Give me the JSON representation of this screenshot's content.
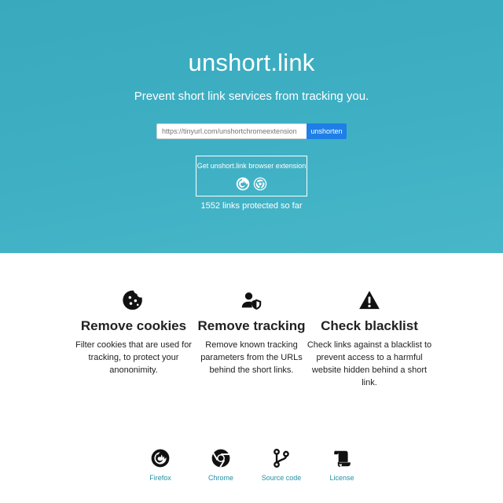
{
  "hero": {
    "title": "unshort.link",
    "subtitle": "Prevent short link services from tracking you.",
    "url_input_placeholder": "https://tinyurl.com/unshortchromeextension",
    "unshorten_label": "unshorten",
    "extension_label": "Get unshort.link browser extension",
    "extension_icons": [
      "firefox-icon",
      "chrome-icon"
    ],
    "counter_text": "1552 links protected so far",
    "background_color": "#3fb0c4",
    "button_color": "#1f7fe6"
  },
  "features": [
    {
      "icon": "cookie-icon",
      "title": "Remove cookies",
      "text": "Filter cookies that are used for tracking, to protect your anononimity."
    },
    {
      "icon": "user-shield-icon",
      "title": "Remove tracking",
      "text": "Remove known tracking parameters from the URLs behind the short links."
    },
    {
      "icon": "warning-icon",
      "title": "Check blacklist",
      "text": "Check links against a blacklist to prevent access to a harmful website hidden behind a short link."
    }
  ],
  "footer": {
    "links": [
      {
        "icon": "firefox-icon",
        "label": "Firefox"
      },
      {
        "icon": "chrome-icon",
        "label": "Chrome"
      },
      {
        "icon": "code-branch-icon",
        "label": "Source code"
      },
      {
        "icon": "scroll-icon",
        "label": "License"
      }
    ],
    "link_color": "#2490a6"
  }
}
